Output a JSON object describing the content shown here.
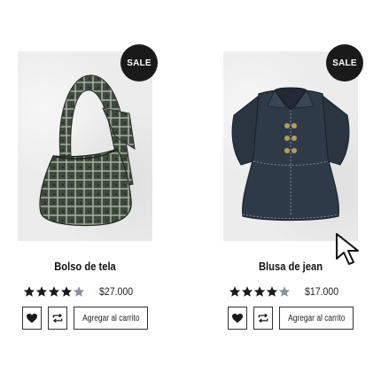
{
  "products": [
    {
      "badge": "SALE",
      "name": "Bolso de tela",
      "rating_stars": 4,
      "rating_max": 5,
      "price": "$27.000",
      "wishlist_icon": "heart-icon",
      "compare_icon": "compare-icon",
      "cart_label": "Agregar al carrito",
      "image": "plaid-shoulder-bag-image"
    },
    {
      "badge": "SALE",
      "name": "Blusa de jean",
      "rating_stars": 4,
      "rating_max": 5,
      "price": "$17.000",
      "wishlist_icon": "heart-icon",
      "compare_icon": "compare-icon",
      "cart_label": "Agregar al carrito",
      "image": "denim-blouse-image"
    }
  ],
  "colors": {
    "badge_bg": "#1a1a1a",
    "star_filled": "#1a1a1a",
    "star_empty": "#8a8f99"
  }
}
